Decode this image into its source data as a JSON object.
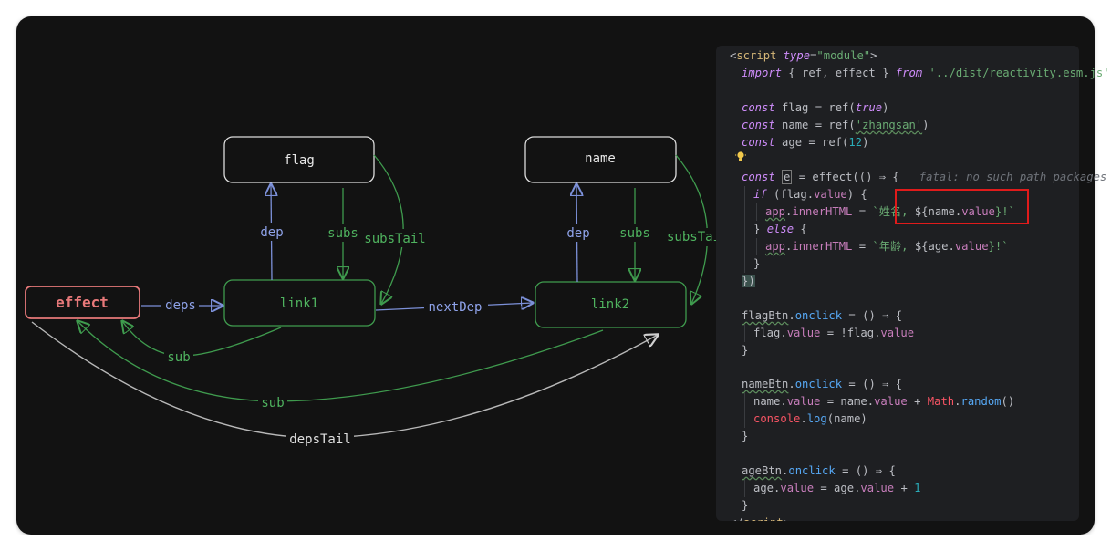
{
  "diagram": {
    "nodes": {
      "effect": "effect",
      "flag": "flag",
      "name": "name",
      "link1": "link1",
      "link2": "link2"
    },
    "edges": {
      "deps": "deps",
      "nextDep": "nextDep",
      "dep1": "dep",
      "subs1": "subs",
      "subsTail1": "subsTail",
      "dep2": "dep",
      "subs2": "subs",
      "subsTail2": "subsTai",
      "sub1": "sub",
      "sub2": "sub",
      "depsTail": "depsTail"
    },
    "colors": {
      "effect": "#e7797a",
      "green": "#3f9b4e",
      "blue": "#7c90d8",
      "white": "#dcdcdc"
    }
  },
  "code": {
    "lines": [
      [
        "<",
        "script",
        " ",
        "type",
        "=",
        "\"module\"",
        ">"
      ],
      [
        "import",
        " { ref, effect } ",
        "from",
        " ",
        "'../dist/reactivity.esm.js'"
      ],
      [],
      [
        "const",
        " flag = ref(",
        "true",
        ")"
      ],
      [
        "const",
        " name = ref(",
        "'zhangsan'",
        ")"
      ],
      [
        "const",
        " age = ref(",
        "12",
        ")"
      ],
      [],
      [
        "const",
        " ",
        "e",
        " = effect(() ⇒ {",
        "fatal: no such path packages"
      ],
      [
        "if",
        " (flag.",
        "value",
        ") {"
      ],
      [
        "app",
        ".",
        "innerHTML",
        " = ",
        "`姓名, ",
        "${name.",
        "value",
        "}!`"
      ],
      [
        "} ",
        "else",
        " {"
      ],
      [
        "app",
        ".",
        "innerHTML",
        " = ",
        "`年龄, ",
        "${age.",
        "value",
        "}!`"
      ],
      [
        "}"
      ],
      [
        "})"
      ],
      [],
      [
        "flagBtn",
        ".",
        "onclick",
        " = () ⇒ {"
      ],
      [
        "flag.",
        "value",
        " = !flag.",
        "value"
      ],
      [
        "}"
      ],
      [],
      [
        "nameBtn",
        ".",
        "onclick",
        " = () ⇒ {"
      ],
      [
        "name.",
        "value",
        " = name.",
        "value",
        " + ",
        "Math",
        ".",
        "random",
        "()"
      ],
      [
        "console",
        ".",
        "log",
        "(name)"
      ],
      [
        "}"
      ],
      [],
      [
        "ageBtn",
        ".",
        "onclick",
        " = () ⇒ {"
      ],
      [
        "age.",
        "value",
        " = age.",
        "value",
        " + ",
        "1"
      ],
      [
        "}"
      ],
      [
        "</",
        "script",
        ">"
      ]
    ]
  }
}
